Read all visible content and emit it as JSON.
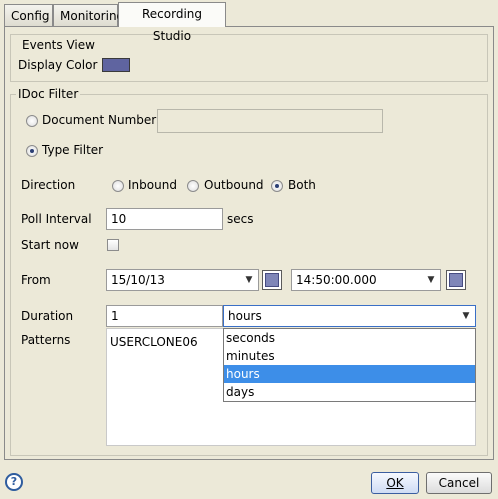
{
  "tabs": [
    "Config",
    "Monitoring",
    "Recording Studio"
  ],
  "events_view": {
    "title": "Events View",
    "display_color_label": "Display Color",
    "display_color": "#7f86b8"
  },
  "idoc_filter": {
    "title": "IDoc Filter",
    "document_number_label": "Document Number",
    "document_number_value": "",
    "type_filter_label": "Type Filter",
    "selected_filter": "Type Filter",
    "direction": {
      "label": "Direction",
      "options": [
        "Inbound",
        "Outbound",
        "Both"
      ],
      "selected": "Both"
    },
    "poll_interval": {
      "label": "Poll Interval",
      "value": "10",
      "unit": "secs"
    },
    "start_now": {
      "label": "Start now",
      "checked": false
    },
    "from": {
      "label": "From",
      "date": "15/10/13",
      "time": "14:50:00.000"
    },
    "duration": {
      "label": "Duration",
      "value": "1",
      "unit_selected": "hours",
      "unit_options": [
        "seconds",
        "minutes",
        "hours",
        "days"
      ],
      "dropdown_open": true
    },
    "patterns": {
      "label": "Patterns",
      "value": "USERCLONE06"
    }
  },
  "footer": {
    "help_icon": "question-mark",
    "ok_label": "OK",
    "cancel_label": "Cancel"
  },
  "colors": {
    "selection": "#3d8ee8",
    "accent": "#3b5ea0"
  }
}
